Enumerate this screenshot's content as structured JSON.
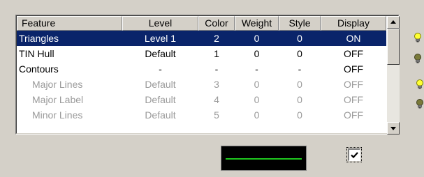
{
  "table": {
    "columns": [
      "Feature",
      "Level",
      "Color",
      "Weight",
      "Style",
      "Display"
    ],
    "rows": [
      {
        "feature": "Triangles",
        "level": "Level 1",
        "color": "2",
        "weight": "0",
        "style": "0",
        "display": "ON"
      },
      {
        "feature": "TIN Hull",
        "level": "Default",
        "color": "1",
        "weight": "0",
        "style": "0",
        "display": "OFF"
      },
      {
        "feature": "Contours",
        "level": "-",
        "color": "-",
        "weight": "-",
        "style": "-",
        "display": "OFF"
      },
      {
        "feature": "Major Lines",
        "level": "Default",
        "color": "3",
        "weight": "0",
        "style": "0",
        "display": "OFF"
      },
      {
        "feature": "Major Label",
        "level": "Default",
        "color": "4",
        "weight": "0",
        "style": "0",
        "display": "OFF"
      },
      {
        "feature": "Minor Lines",
        "level": "Default",
        "color": "5",
        "weight": "0",
        "style": "0",
        "display": "OFF"
      }
    ],
    "selected_row": "Triangles"
  },
  "preview": {
    "line_color": "#1ec81e",
    "background": "#000000"
  },
  "display_checkbox": {
    "checked": true
  },
  "bulbs": [
    {
      "icon": "bulb-on-icon",
      "state": "on"
    },
    {
      "icon": "bulb-off-icon",
      "state": "off"
    },
    {
      "icon": "bulb-on-icon",
      "state": "on"
    },
    {
      "icon": "bulb-off-icon",
      "state": "off"
    }
  ],
  "colors": {
    "selection": "#0a246a",
    "disabled_text": "#9a9a9a",
    "face": "#d4d0c8"
  }
}
